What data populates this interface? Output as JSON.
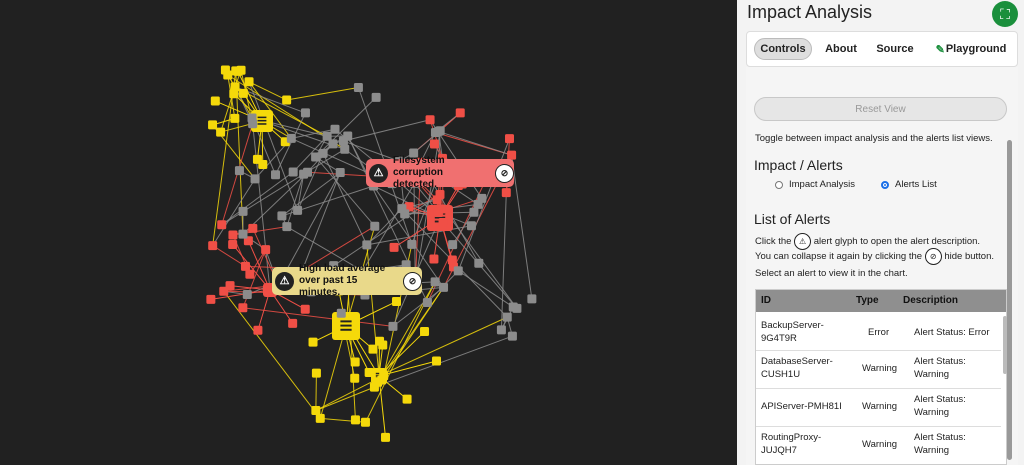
{
  "panel": {
    "title": "Impact Analysis",
    "tabs": [
      {
        "label": "Controls",
        "active": true
      },
      {
        "label": "About",
        "active": false
      },
      {
        "label": "Source",
        "active": false
      },
      {
        "label": "Playground",
        "active": false
      }
    ],
    "reset_label": "Reset View",
    "toggle_text": "Toggle between impact analysis and the alerts list views.",
    "impact_heading": "Impact / Alerts",
    "radio_impact": "Impact Analysis",
    "radio_alerts": "Alerts List",
    "selected_view": "Alerts List",
    "list_heading": "List of Alerts",
    "help_click": "Click the",
    "help_glyph": "alert glyph to open the alert description.",
    "help_collapse": "You can collapse it again by clicking the",
    "help_hide": "hide button.",
    "help_select": "Select an alert to view it in the chart.",
    "table": {
      "headers": [
        "ID",
        "Type",
        "Description"
      ],
      "rows": [
        {
          "id": "BackupServer-9G4T9R",
          "type": "Error",
          "desc": "Alert Status: Error"
        },
        {
          "id": "DatabaseServer-CUSH1U",
          "type": "Warning",
          "desc": "Alert Status: Warning"
        },
        {
          "id": "APIServer-PMH81I",
          "type": "Warning",
          "desc": "Alert Status: Warning"
        },
        {
          "id": "RoutingProxy-JUJQH7",
          "type": "Warning",
          "desc": "Alert Status: Warning"
        }
      ]
    }
  },
  "graph": {
    "callouts": [
      {
        "text": "Filesystem corruption detected.",
        "status": "error",
        "color": "#f07070"
      },
      {
        "text": "High load average over past 15 minutes.",
        "status": "warning",
        "color": "#e9d98a"
      }
    ],
    "colors": {
      "ok": "#8c8c8c",
      "warning": "#f5d90a",
      "error": "#f04f46",
      "background": "#212121"
    }
  },
  "icons": {
    "fullscreen": "fullscreen-icon",
    "alert": "alert-triangle-icon",
    "hide": "eye-slash-icon",
    "playground": "edit-icon"
  }
}
